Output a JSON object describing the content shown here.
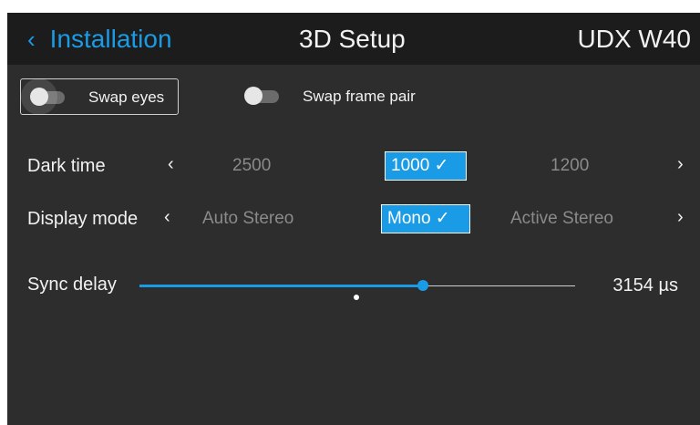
{
  "header": {
    "back_label": "Installation",
    "back_icon": "chevron-left-icon",
    "title": "3D Setup",
    "model": "UDX W40"
  },
  "toggles": [
    {
      "label": "Swap eyes",
      "on": false,
      "focused": true
    },
    {
      "label": "Swap frame pair",
      "on": false,
      "focused": false
    }
  ],
  "dark_time": {
    "label": "Dark time",
    "options": [
      "2500",
      "1000 ✓",
      "1200"
    ],
    "selected": "1000"
  },
  "display_mode": {
    "label": "Display mode",
    "options": [
      "Auto Stereo",
      "Mono ✓",
      "Active Stereo"
    ],
    "selected": "Mono"
  },
  "sync_delay": {
    "label": "Sync delay",
    "value_text": "3154 µs",
    "fraction": 0.65
  },
  "colors": {
    "accent": "#1a9be6",
    "background": "#2d2d2d",
    "header": "#1c1c1c"
  }
}
